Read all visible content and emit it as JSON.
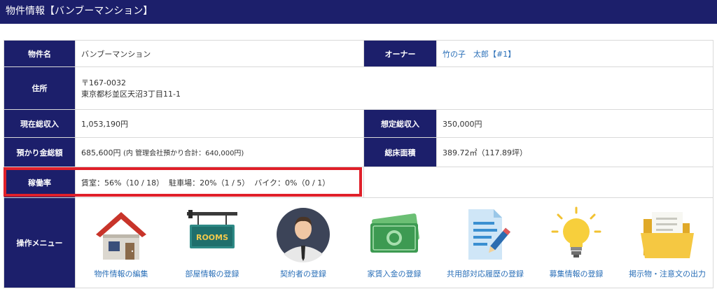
{
  "header": {
    "title": "物件情報【バンブーマンション】"
  },
  "property": {
    "name_label": "物件名",
    "name_value": "バンブーマンション",
    "owner_label": "オーナー",
    "owner_value": "竹の子　太郎【#1】",
    "address_label": "住所",
    "postal_code": "〒167-0032",
    "address": "東京都杉並区天沼3丁目11-1",
    "current_income_label": "現在総収入",
    "current_income_value": "1,053,190円",
    "expected_income_label": "想定総収入",
    "expected_income_value": "350,000円",
    "deposit_label": "預かり金総額",
    "deposit_value": "685,600円",
    "deposit_note": "(内 管理会社預かり合計：640,000円)",
    "floor_area_label": "総床面積",
    "floor_area_value": "389.72㎡（117.89坪）",
    "occupancy_label": "稼働率",
    "occupancy_value": "賃室：56%（10 / 18）  駐車場：20%（1 / 5）  バイク：0%（0 / 1）"
  },
  "menu": {
    "label": "操作メニュー",
    "items": [
      {
        "label": "物件情報の編集",
        "icon": "house-icon"
      },
      {
        "label": "部屋情報の登録",
        "icon": "rooms-sign-icon"
      },
      {
        "label": "契約者の登録",
        "icon": "person-icon"
      },
      {
        "label": "家賃入金の登録",
        "icon": "money-icon"
      },
      {
        "label": "共用部対応履歴の登録",
        "icon": "document-pen-icon"
      },
      {
        "label": "募集情報の登録",
        "icon": "lightbulb-icon"
      },
      {
        "label": "掲示物・注意文の出力",
        "icon": "folder-icon"
      }
    ],
    "rooms_sign_text": "ROOMS"
  },
  "colors": {
    "header_bg": "#1c1f6b",
    "link": "#2a6fb8",
    "highlight": "#e0202a"
  }
}
